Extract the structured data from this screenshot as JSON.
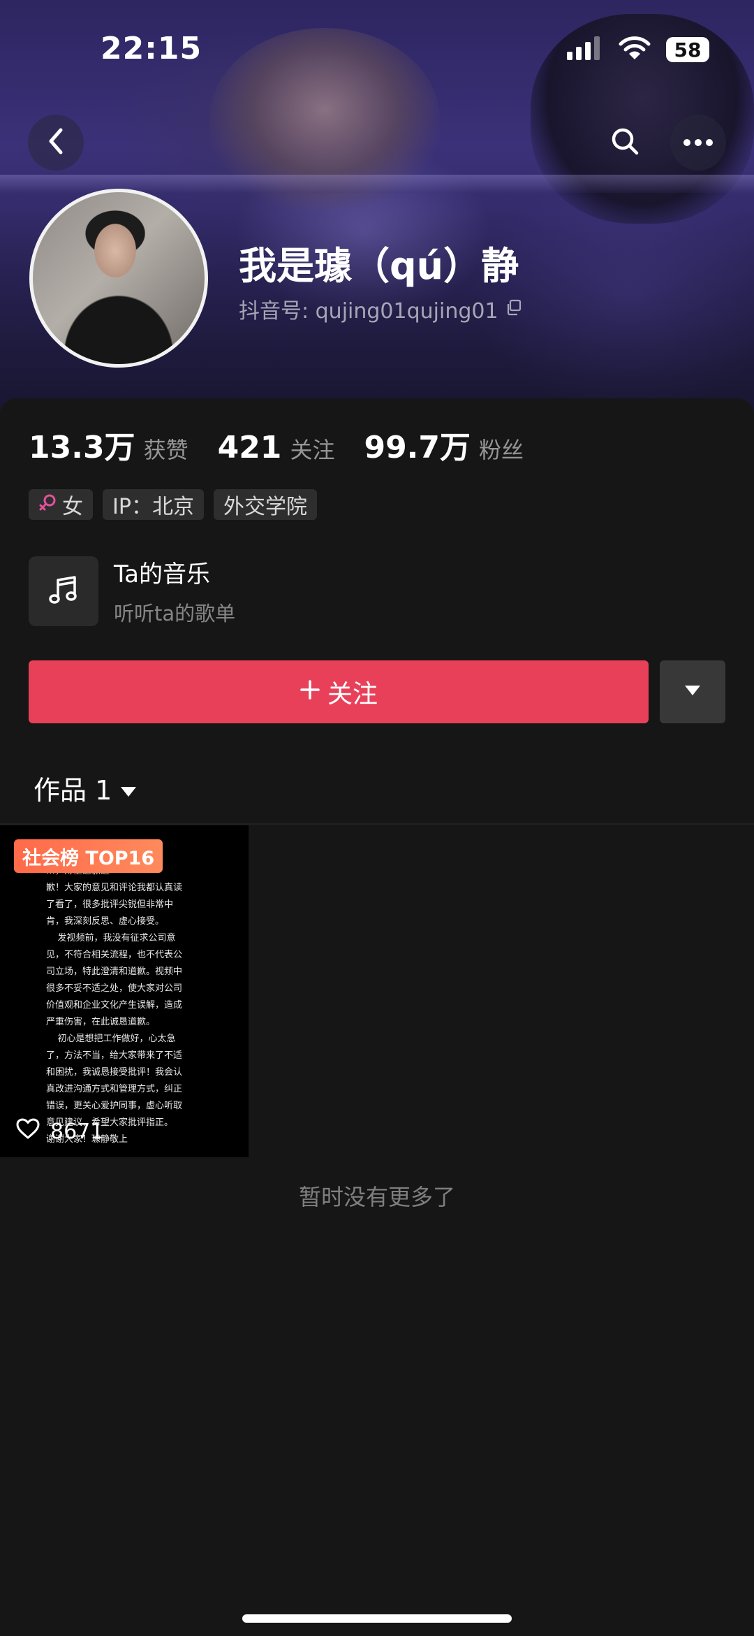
{
  "status_bar": {
    "time": "22:15",
    "battery": "58"
  },
  "header": {
    "display_name": "我是璩（qú）静",
    "douyin_id": "抖音号: qujing01qujing01"
  },
  "stats": [
    {
      "value": "13.3万",
      "label": "获赞"
    },
    {
      "value": "421",
      "label": "关注"
    },
    {
      "value": "99.7万",
      "label": "粉丝"
    }
  ],
  "tags": {
    "gender": "女",
    "ip": "IP：北京",
    "school": "外交学院"
  },
  "music": {
    "title": "Ta的音乐",
    "subtitle": "听听ta的歌单"
  },
  "actions": {
    "follow_label": "关注"
  },
  "works_tab": {
    "label": "作品 1"
  },
  "video": {
    "rank_badge": "社会榜 TOP16",
    "likes": "8671",
    "overlay_text": "…频引起了\n…，郑重道歉道\n歉！大家的意见和评论我都认真读\n了看了，很多批评尖锐但非常中\n肯，我深刻反思、虚心接受。\n    发视频前，我没有征求公司意\n见，不符合相关流程，也不代表公\n司立场，特此澄清和道歉。视频中\n很多不妥不适之处，使大家对公司\n价值观和企业文化产生误解，造成\n严重伤害，在此诚恳道歉。\n    初心是想把工作做好，心太急\n了，方法不当，给大家带来了不适\n和困扰，我诚恳接受批评！我会认\n真改进沟通方式和管理方式，纠正\n错误，更关心爱护同事，虚心听取\n意见建议，希望大家批评指正。\n谢谢大家！璩静敬上"
  },
  "footer": {
    "no_more": "暂时没有更多了"
  },
  "colors": {
    "background": "#161616",
    "follow_button": "#e9405a",
    "rank_badge": "#ff7350",
    "gender_icon": "#e0529a"
  },
  "icons": [
    "back-arrow-icon",
    "search-icon",
    "more-dots-icon",
    "copy-icon",
    "female-icon",
    "music-note-icon",
    "plus-icon",
    "triangle-down-icon",
    "heart-outline-icon",
    "signal-icon",
    "wifi-icon"
  ]
}
